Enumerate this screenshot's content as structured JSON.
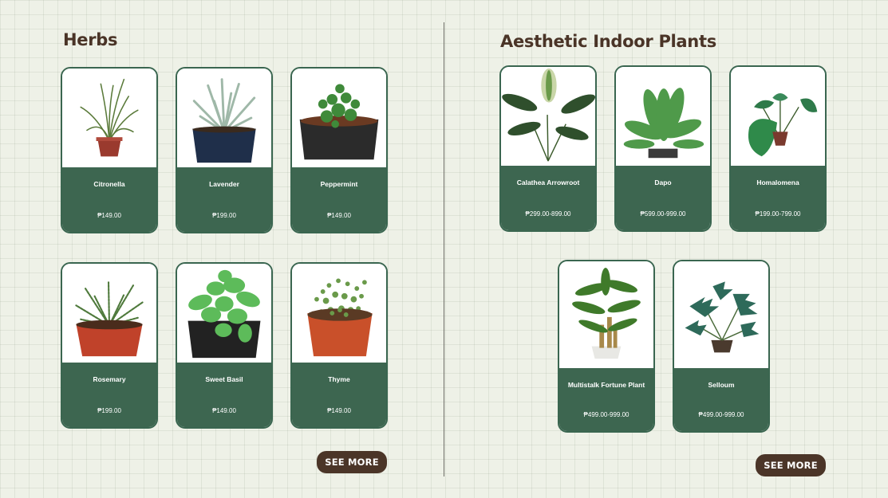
{
  "herbs": {
    "title": "Herbs",
    "see_more": "SEE MORE",
    "products": [
      {
        "name": "Citronella",
        "price": "₱149.00",
        "icon": "citronella-plant-icon"
      },
      {
        "name": "Lavender",
        "price": "₱199.00",
        "icon": "lavender-plant-icon"
      },
      {
        "name": "Peppermint",
        "price": "₱149.00",
        "icon": "peppermint-plant-icon"
      },
      {
        "name": "Rosemary",
        "price": "₱199.00",
        "icon": "rosemary-plant-icon"
      },
      {
        "name": "Sweet Basil",
        "price": "₱149.00",
        "icon": "sweet-basil-plant-icon"
      },
      {
        "name": "Thyme",
        "price": "₱149.00",
        "icon": "thyme-plant-icon"
      }
    ]
  },
  "indoor": {
    "title": "Aesthetic Indoor Plants",
    "see_more": "SEE MORE",
    "products": [
      {
        "name": "Calathea Arrowroot",
        "price": "₱299.00-899.00",
        "icon": "calathea-plant-icon"
      },
      {
        "name": "Dapo",
        "price": "₱599.00-999.00",
        "icon": "dapo-plant-icon"
      },
      {
        "name": "Homalomena",
        "price": "₱199.00-799.00",
        "icon": "homalomena-plant-icon"
      },
      {
        "name": "Multistalk Fortune Plant",
        "price": "₱499.00-999.00",
        "icon": "fortune-plant-icon"
      },
      {
        "name": "Selloum",
        "price": "₱499.00-999.00",
        "icon": "selloum-plant-icon"
      }
    ]
  },
  "colors": {
    "background": "#eef1e7",
    "card_green": "#3d6650",
    "button_brown": "#4b3528",
    "title_brown": "#4a3427"
  }
}
